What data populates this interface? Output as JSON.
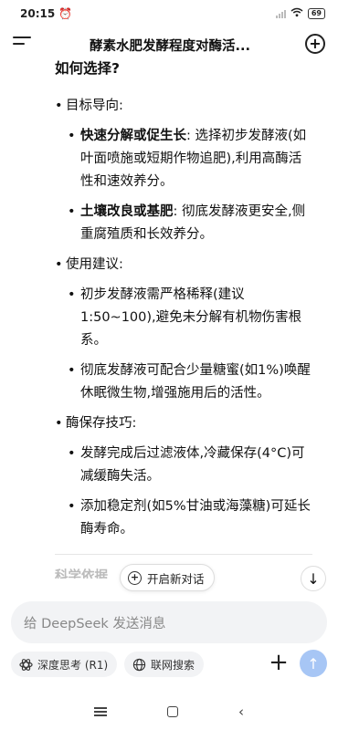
{
  "status": {
    "time": "20:15",
    "battery": "69"
  },
  "header": {
    "title": "酵素水肥发酵程度对酶活..."
  },
  "content": {
    "heading": "如何选择?",
    "sections": [
      {
        "label": "目标导向:",
        "items": [
          {
            "bold": "快速分解或促生长",
            "text": ": 选择初步发酵液(如叶面喷施或短期作物追肥),利用高酶活性和速效养分。"
          },
          {
            "bold": "土壤改良或基肥",
            "text": ": 彻底发酵液更安全,侧重腐殖质和长效养分。"
          }
        ]
      },
      {
        "label": "使用建议:",
        "items": [
          {
            "bold": "",
            "text": "初步发酵液需严格稀释(建议1:50~100),避免未分解有机物伤害根系。"
          },
          {
            "bold": "",
            "text": "彻底发酵液可配合少量糖蜜(如1%)唤醒休眠微生物,增强施用后的活性。"
          }
        ]
      },
      {
        "label": "酶保存技巧:",
        "items": [
          {
            "bold": "",
            "text": "发酵完成后过滤液体,冷藏保存(4°C)可减缓酶失活。"
          },
          {
            "bold": "",
            "text": "添加稳定剂(如5%甘油或海藻糖)可延长酶寿命。"
          }
        ]
      }
    ],
    "next_heading": "科学依据"
  },
  "floating": {
    "new_dialog_label": "开启新对话"
  },
  "input": {
    "placeholder": "给 DeepSeek 发送消息"
  },
  "chips": {
    "deepthink": "深度思考 (R1)",
    "search": "联网搜索"
  }
}
